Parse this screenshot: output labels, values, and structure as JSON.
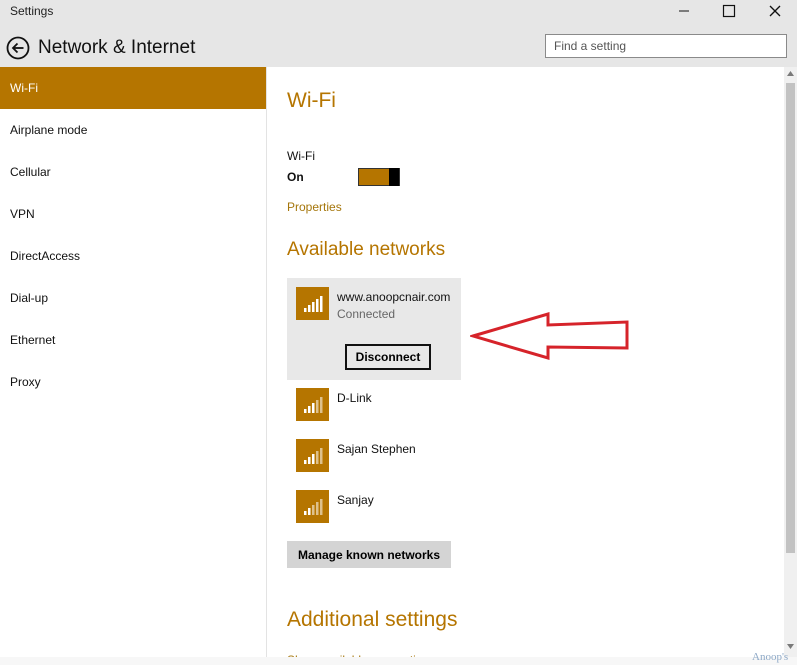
{
  "window": {
    "title": "Settings"
  },
  "header": {
    "title": "Network & Internet",
    "search_placeholder": "Find a setting"
  },
  "sidebar": {
    "items": [
      {
        "label": "Wi-Fi",
        "active": true
      },
      {
        "label": "Airplane mode"
      },
      {
        "label": "Cellular"
      },
      {
        "label": "VPN"
      },
      {
        "label": "DirectAccess"
      },
      {
        "label": "Dial-up"
      },
      {
        "label": "Ethernet"
      },
      {
        "label": "Proxy"
      }
    ]
  },
  "main": {
    "heading": "Wi-Fi",
    "wifi_label": "Wi-Fi",
    "wifi_state": "On",
    "properties_link": "Properties",
    "available_heading": "Available networks",
    "networks": [
      {
        "name": "www.anoopcnair.com",
        "status": "Connected",
        "action": "Disconnect"
      },
      {
        "name": "D-Link"
      },
      {
        "name": "Sajan Stephen"
      },
      {
        "name": "Sanjay"
      }
    ],
    "manage_button": "Manage known networks",
    "additional_heading": "Additional settings",
    "additional_link": "Show available connections"
  },
  "watermark": "Anoop's",
  "colors": {
    "accent": "#b57500",
    "annotation_arrow": "#d6232a"
  },
  "icons": {
    "back": "back-arrow-icon",
    "wifi": "wifi-signal-icon",
    "minimize": "minimize-icon",
    "maximize": "maximize-icon",
    "close": "close-icon"
  }
}
